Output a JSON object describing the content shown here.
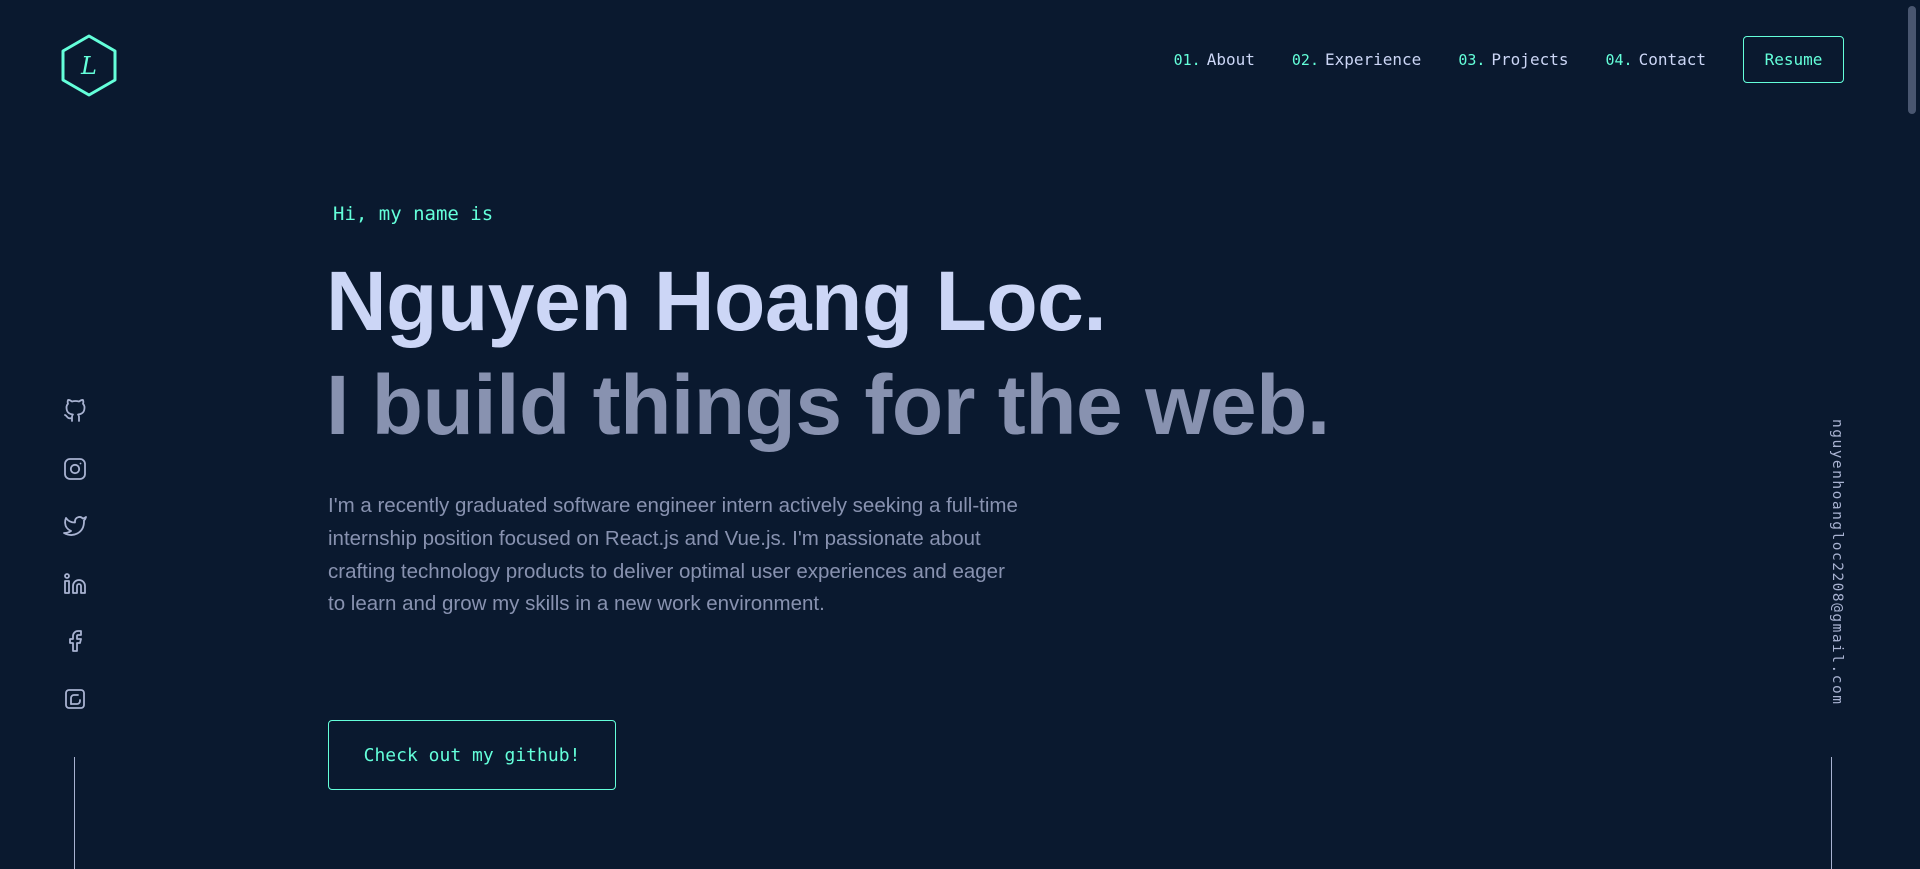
{
  "logo": {
    "letter": "L",
    "icon": "hexagon-logo-icon",
    "accent": "#64ffda"
  },
  "nav": {
    "items": [
      {
        "num": "01.",
        "label": "About"
      },
      {
        "num": "02.",
        "label": "Experience"
      },
      {
        "num": "03.",
        "label": "Projects"
      },
      {
        "num": "04.",
        "label": "Contact"
      }
    ],
    "resume_label": "Resume"
  },
  "hero": {
    "greeting": "Hi, my name is",
    "name": "Nguyen Hoang Loc.",
    "tagline": "I build things for the web.",
    "intro": "I'm a recently graduated software engineer intern actively seeking a full-time internship position focused on React.js and Vue.js. I'm passionate about crafting technology products to deliver optimal user experiences and eager to learn and grow my skills in a new work environment.",
    "cta_label": "Check out my github!"
  },
  "social": {
    "icons": [
      "github-icon",
      "instagram-icon",
      "twitter-icon",
      "linkedin-icon",
      "facebook-icon",
      "codepen-icon"
    ]
  },
  "email": "nguyenhoangloc2208@gmail.com",
  "colors": {
    "background": "#0a192f",
    "accent": "#64ffda",
    "heading": "#ccd6f6",
    "text": "#8892b0",
    "light": "#a8b2d1"
  }
}
